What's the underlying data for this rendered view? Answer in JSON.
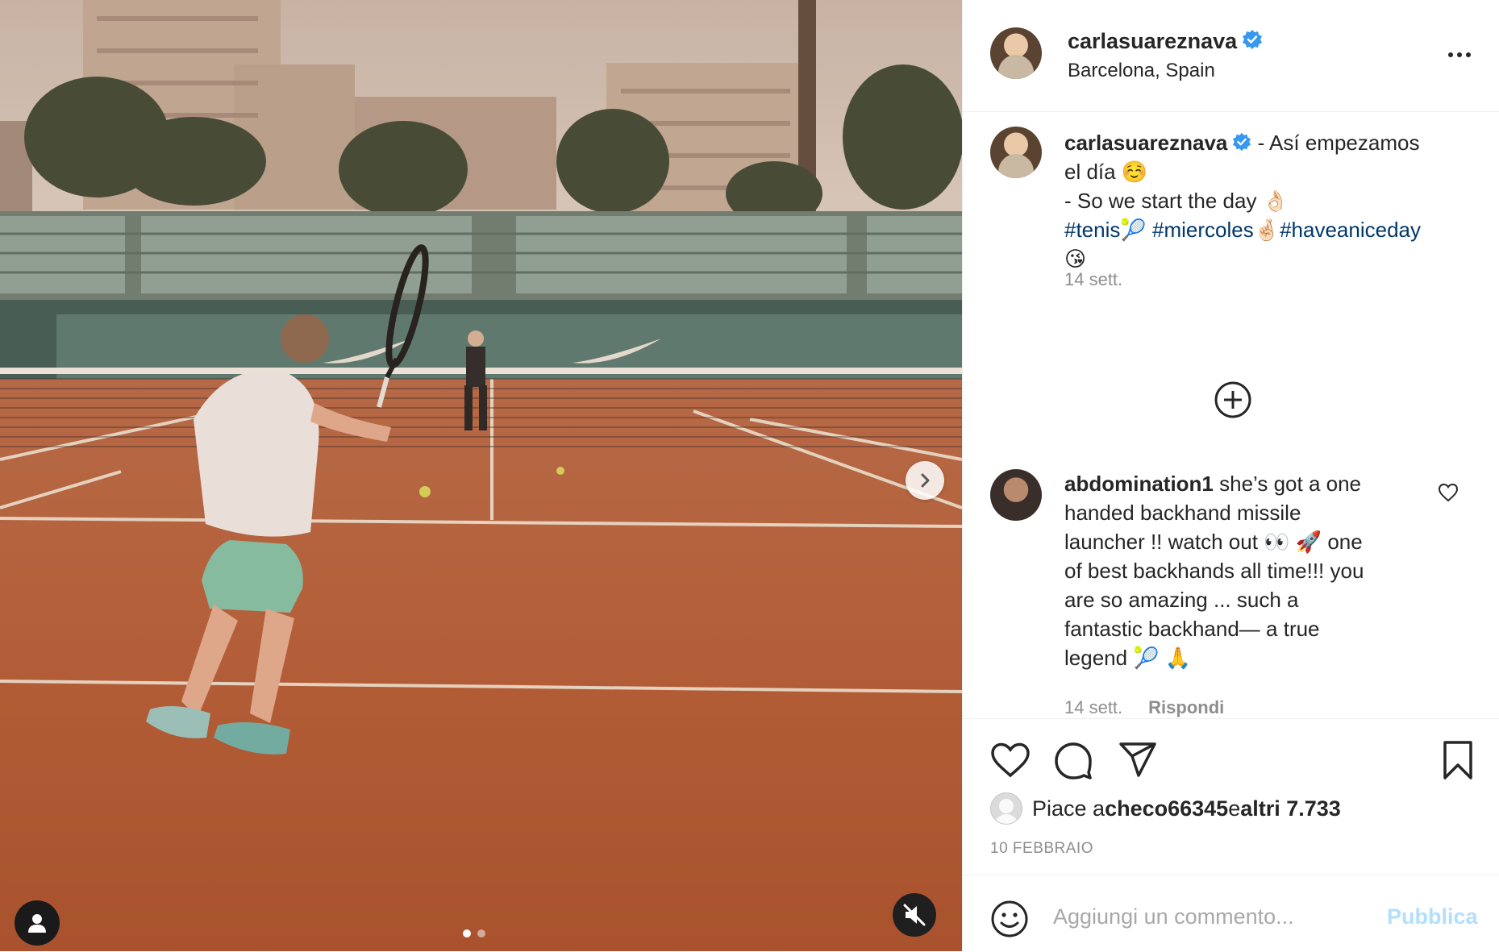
{
  "header": {
    "username": "carlasuareznava",
    "location": "Barcelona, Spain"
  },
  "caption": {
    "username": "carlasuareznava",
    "line1": " - Así empezamos",
    "line2": "el día ☺️",
    "line3": "- So we start the day 👌🏻",
    "hashtag1": "#tenis",
    "emoji1": "🎾",
    "hashtag2": "#miercoles",
    "emoji2": "🤞🏻",
    "hashtag3": "#haveaniceday",
    "line5": "😘",
    "time": "14 sett."
  },
  "comment": {
    "username": "abdomination1",
    "lines": [
      " she’s got a one",
      "handed backhand missile",
      "launcher !! watch out 👀 🚀 one",
      "of best backhands all time!!! you",
      "are so amazing ... such a",
      "fantastic backhand— a true",
      "legend 🎾 🙏"
    ],
    "time": "14 sett.",
    "reply_label": "Rispondi"
  },
  "likes": {
    "prefix": "Piace a ",
    "user": "checo66345",
    "middle": " e ",
    "others": "altri 7.733"
  },
  "date": "10 FEBBRAIO",
  "add_comment": {
    "placeholder": "Aggiungi un commento...",
    "publish_label": "Pubblica"
  },
  "carousel": {
    "current": 1,
    "total": 2
  }
}
